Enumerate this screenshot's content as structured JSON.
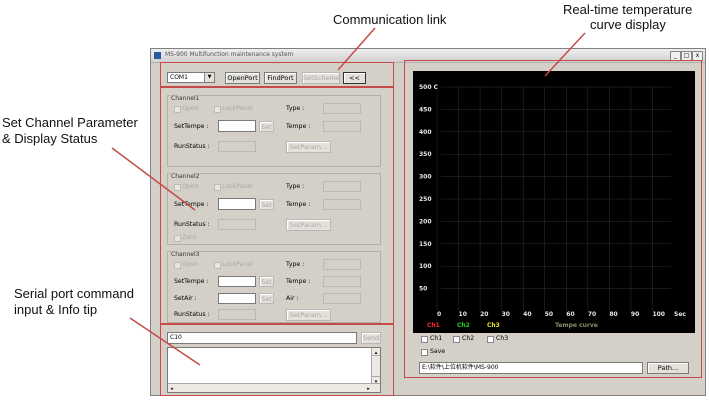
{
  "annotations": {
    "comm_link": "Communication link",
    "realtime_line1": "Real-time temperature",
    "realtime_line2": "curve display",
    "set_channel_line1": "Set Channel Parameter",
    "set_channel_line2": "& Display Status",
    "serial_line1": "Serial port command",
    "serial_line2": "input & Info tip"
  },
  "window": {
    "title": "MS-900 Multifunction maintenance system",
    "min": "_",
    "max": "□",
    "close": "x"
  },
  "toolbar": {
    "port_value": "COM1",
    "open_port": "OpenPort",
    "find_port": "FindPort",
    "set_scheme": "SetScheme",
    "collapse": "<<"
  },
  "channel1": {
    "title": "Channel1",
    "open": "Open",
    "lockpanel": "LockPanel",
    "type": "Type :",
    "settempe": "SetTempe :",
    "set": "Set",
    "tempe": "Tempe :",
    "runstatus": "RunStatus :",
    "setparam": "SetParam..."
  },
  "channel2": {
    "title": "Channel2",
    "open": "Open",
    "lockpanel": "LockPanel",
    "type": "Type :",
    "settempe": "SetTempe :",
    "set": "Set",
    "tempe": "Tempe :",
    "runstatus": "RunStatus :",
    "setparam": "SetParam...",
    "zero": "Zero"
  },
  "channel3": {
    "title": "Channel3",
    "open": "Open",
    "lockpanel": "LockPanel",
    "type": "Type :",
    "settempe": "SetTempe :",
    "set": "Set",
    "tempe": "Tempe :",
    "setair": "SetAir :",
    "air": "Air :",
    "runstatus": "RunStatus :",
    "setparam": "SetParam..."
  },
  "serial": {
    "command": "C10",
    "send": "Send"
  },
  "chart": {
    "y_ticks": [
      "500 C",
      "450",
      "400",
      "350",
      "300",
      "250",
      "200",
      "150",
      "100",
      "50"
    ],
    "x_ticks": [
      "0",
      "10",
      "20",
      "30",
      "40",
      "50",
      "60",
      "70",
      "80",
      "90",
      "100",
      "Sec"
    ],
    "legend": {
      "ch1": "Ch1",
      "ch2": "Ch2",
      "ch3": "Ch3",
      "title": "Tempe curve"
    },
    "colors": {
      "ch1": "#ff2020",
      "ch2": "#20d020",
      "ch3": "#e8e020",
      "title": "#8c8c6a",
      "background": "#000000",
      "grid": "#333333"
    }
  },
  "right_controls": {
    "ch1": "Ch1",
    "ch2": "Ch2",
    "ch3": "Ch3",
    "save": "Save",
    "path_value": "E:\\软件\\上位机软件\\MS-900",
    "path_button": "Path..."
  },
  "accent_colors": {
    "annotation_box": "#c54a4a"
  }
}
